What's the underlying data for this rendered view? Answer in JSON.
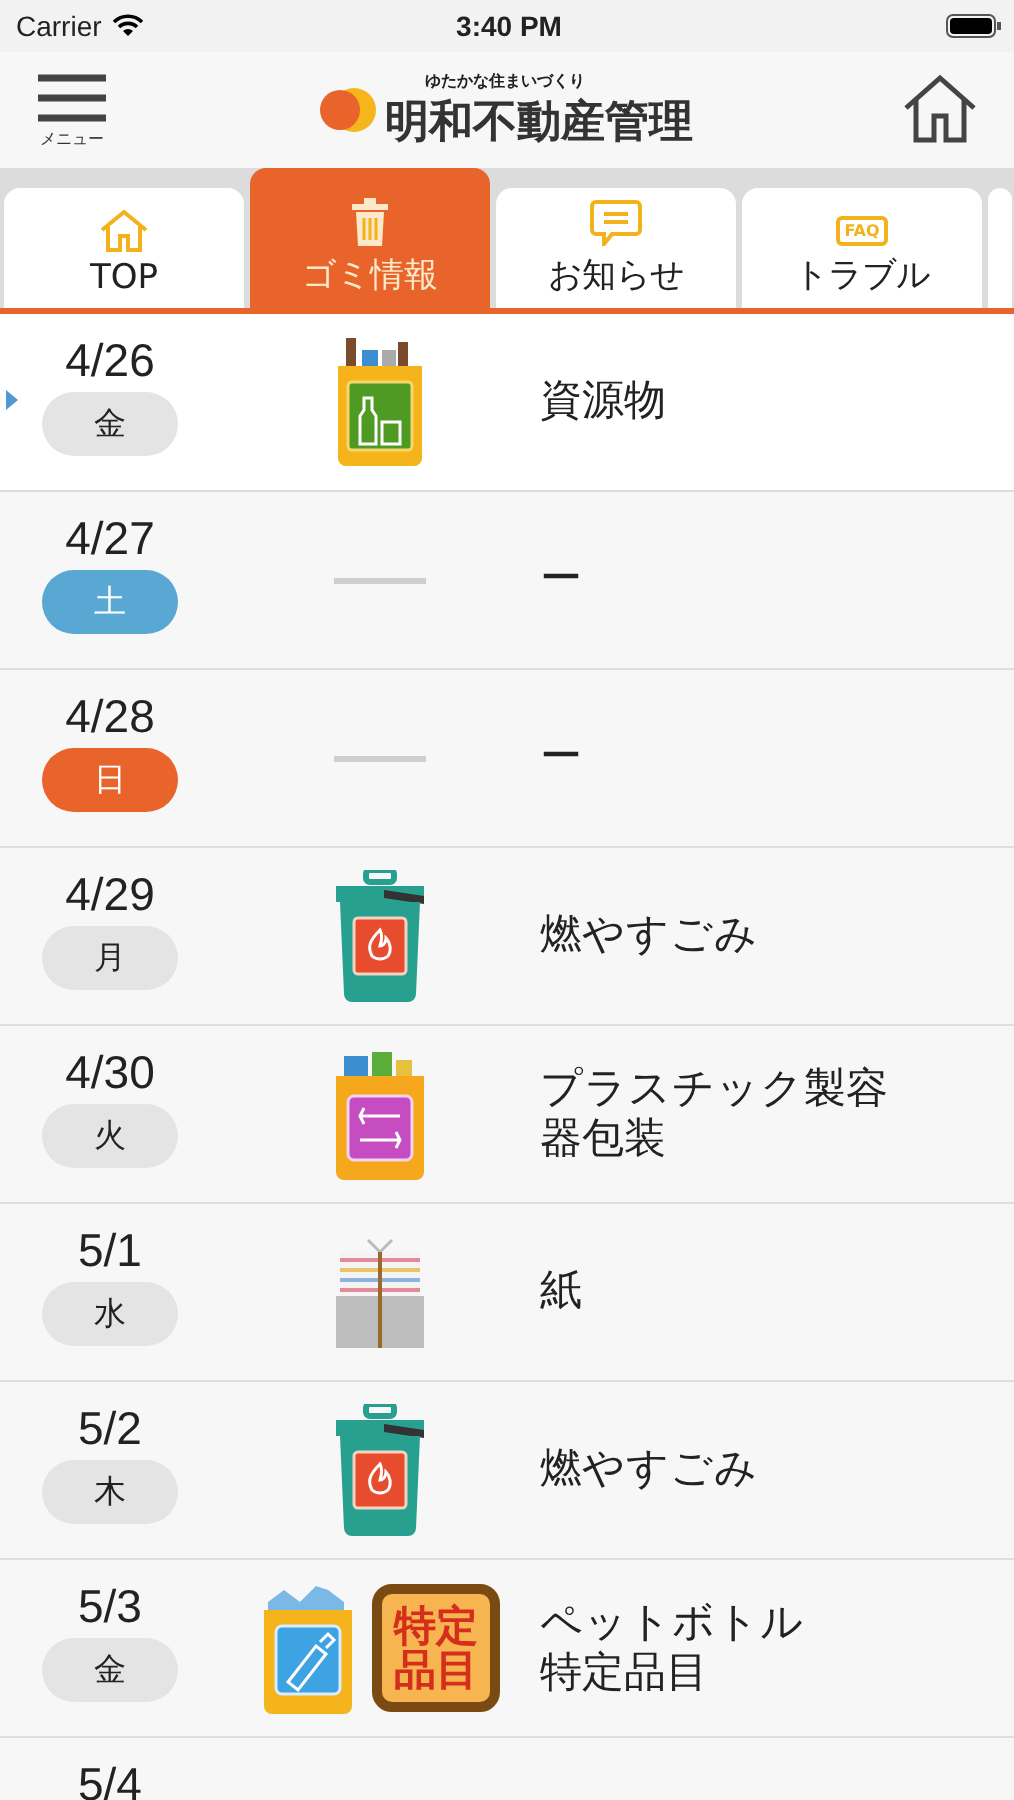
{
  "status_bar": {
    "carrier": "Carrier",
    "time": "3:40 PM"
  },
  "header": {
    "menu_label": "メニュー",
    "tagline": "ゆたかな住まいづくり",
    "brand": "明和不動産管理"
  },
  "tabs": [
    {
      "label": "TOP",
      "kind": "home",
      "selected": false
    },
    {
      "label": "ゴミ情報",
      "kind": "trash",
      "selected": true
    },
    {
      "label": "お知らせ",
      "kind": "message",
      "selected": false
    },
    {
      "label": "トラブル",
      "kind": "faq",
      "icon_text": "FAQ",
      "selected": false
    },
    {
      "kind": "stub",
      "selected": false
    }
  ],
  "rows": [
    {
      "date": "4/26",
      "weekday": {
        "text": "金",
        "kind": "weekday"
      },
      "selected": true,
      "icons": [
        {
          "kind": "resource"
        }
      ],
      "label": [
        "資源物"
      ]
    },
    {
      "date": "4/27",
      "weekday": {
        "text": "土",
        "kind": "saturday"
      },
      "selected": false,
      "icons": [
        {
          "kind": "none"
        }
      ],
      "label": [
        "ー"
      ]
    },
    {
      "date": "4/28",
      "weekday": {
        "text": "日",
        "kind": "sunday"
      },
      "selected": false,
      "icons": [
        {
          "kind": "none"
        }
      ],
      "label": [
        "ー"
      ]
    },
    {
      "date": "4/29",
      "weekday": {
        "text": "月",
        "kind": "weekday"
      },
      "selected": false,
      "icons": [
        {
          "kind": "burnable"
        }
      ],
      "label": [
        "燃やすごみ"
      ]
    },
    {
      "date": "4/30",
      "weekday": {
        "text": "火",
        "kind": "weekday"
      },
      "selected": false,
      "icons": [
        {
          "kind": "plastic"
        }
      ],
      "label": [
        "プラスチック製容",
        "器包装"
      ]
    },
    {
      "date": "5/1",
      "weekday": {
        "text": "水",
        "kind": "weekday"
      },
      "selected": false,
      "icons": [
        {
          "kind": "paper"
        }
      ],
      "label": [
        "紙"
      ]
    },
    {
      "date": "5/2",
      "weekday": {
        "text": "木",
        "kind": "weekday"
      },
      "selected": false,
      "icons": [
        {
          "kind": "burnable"
        }
      ],
      "label": [
        "燃やすごみ"
      ]
    },
    {
      "date": "5/3",
      "weekday": {
        "text": "金",
        "kind": "weekday"
      },
      "selected": false,
      "icons": [
        {
          "kind": "pet"
        },
        {
          "kind": "special",
          "text": "特定品目"
        }
      ],
      "label": [
        "ペットボトル",
        "特定品目"
      ]
    },
    {
      "date": "5/4",
      "icons": []
    }
  ]
}
